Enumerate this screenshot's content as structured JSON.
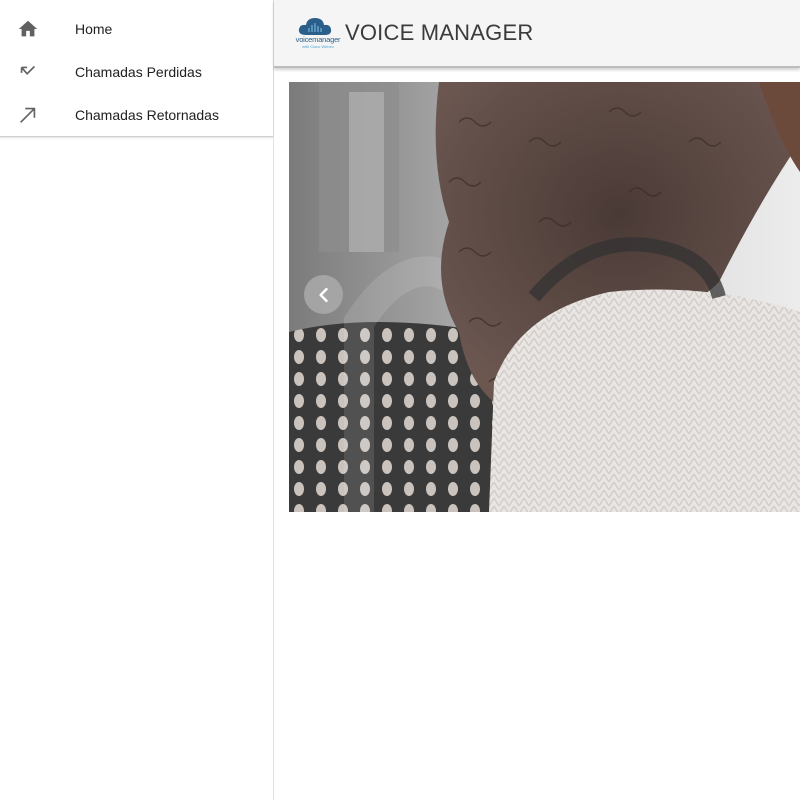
{
  "sidebar": {
    "items": [
      {
        "label": "Home",
        "icon": "home-icon"
      },
      {
        "label": "Chamadas Perdidas",
        "icon": "missed-call-icon"
      },
      {
        "label": "Chamadas Retornadas",
        "icon": "call-made-icon"
      }
    ]
  },
  "header": {
    "title": "VOICE MANAGER",
    "logo_text": "voicemanager",
    "logo_subtext": "with Cisco Webex"
  },
  "carousel": {
    "prev_icon": "chevron-left-icon"
  },
  "colors": {
    "topbar_bg": "#f5f5f5",
    "logo_blue": "#2b5f8a",
    "icon_gray": "#616161"
  }
}
